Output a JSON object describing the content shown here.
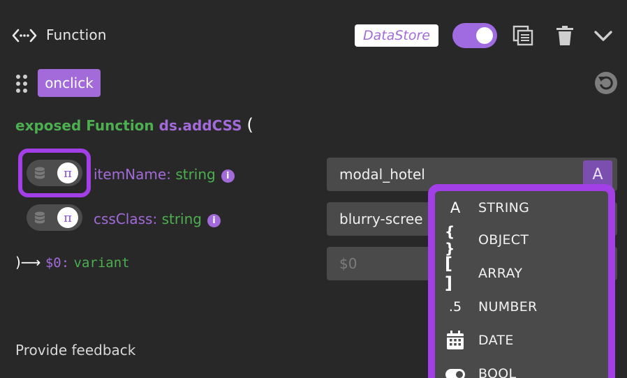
{
  "header": {
    "title": "Function",
    "datastore_badge": "DataStore",
    "enabled": true
  },
  "event": {
    "label": "onclick"
  },
  "signature": {
    "modifier": "exposed Function",
    "function_name": "ds.addCSS",
    "open_paren": "("
  },
  "params": [
    {
      "name": "itemName",
      "type": "string",
      "value": "modal_hotel",
      "mode_symbol": "π"
    },
    {
      "name": "cssClass",
      "type": "string",
      "value": "blurry-scree",
      "mode_symbol": "π"
    }
  ],
  "returns": {
    "arrow": ")⟶",
    "variable": "$0:",
    "type": "variant",
    "placeholder": "$0"
  },
  "type_button": {
    "label": "A"
  },
  "type_menu": {
    "items": [
      {
        "icon": "A",
        "icon_name": "string-icon",
        "label": "STRING"
      },
      {
        "icon": "{ }",
        "icon_name": "object-icon",
        "label": "OBJECT"
      },
      {
        "icon": "[ ]",
        "icon_name": "array-icon",
        "label": "ARRAY"
      },
      {
        "icon": ".5",
        "icon_name": "number-icon",
        "label": "NUMBER"
      },
      {
        "icon": "",
        "icon_name": "calendar-icon",
        "label": "DATE"
      },
      {
        "icon": "",
        "icon_name": "bool-icon",
        "label": "BOOL"
      }
    ]
  },
  "footer": {
    "feedback": "Provide feedback"
  },
  "colors": {
    "background": "#282828",
    "accent_purple": "#a26bd9",
    "highlight": "#a23fe6",
    "type_green": "#4caf50",
    "input_bg": "#4a4a4a"
  }
}
